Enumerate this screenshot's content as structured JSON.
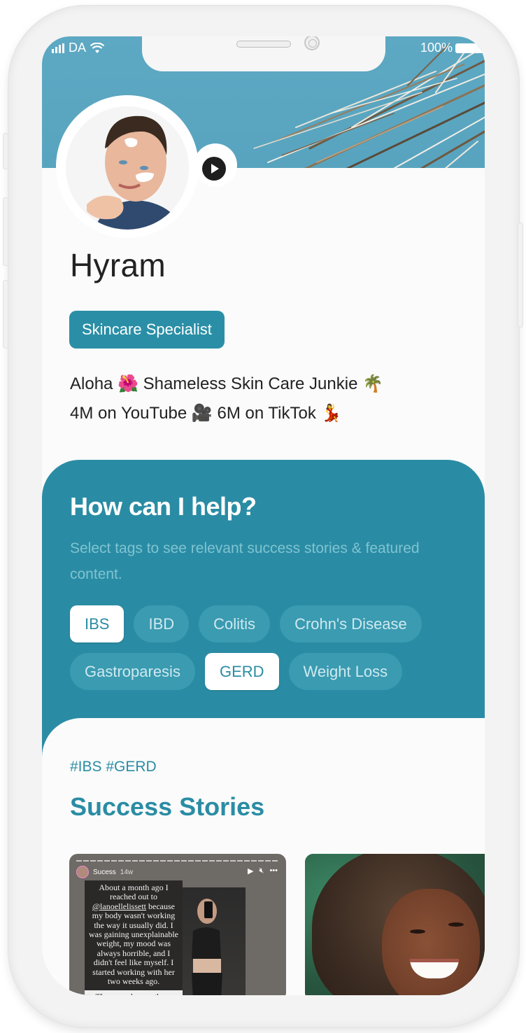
{
  "status_bar": {
    "carrier": "DA",
    "battery": "100%"
  },
  "profile": {
    "name": "Hyram",
    "role": "Skincare Specialist",
    "bio_line1": "Aloha 🌺 Shameless Skin Care Junkie 🌴",
    "bio_line2": "4M on YouTube 🎥 6M on TikTok 💃",
    "play_icon": "play-icon"
  },
  "help": {
    "title": "How can I help?",
    "subtitle": "Select tags to see relevant success stories & featured content.",
    "tags": [
      {
        "label": "IBS",
        "selected": true
      },
      {
        "label": "IBD",
        "selected": false
      },
      {
        "label": "Colitis",
        "selected": false
      },
      {
        "label": "Crohn's Disease",
        "selected": false
      },
      {
        "label": "Gastroparesis",
        "selected": false
      },
      {
        "label": "GERD",
        "selected": true
      },
      {
        "label": "Weight Loss",
        "selected": false
      }
    ]
  },
  "stories": {
    "hashtags": "#IBS #GERD",
    "title": "Success Stories",
    "cards": [
      {
        "account": "Sucess",
        "time": "14w",
        "text_mention": "@lanoellelissett",
        "text_before": "About a month ago I reached out to",
        "text_after": "because my body wasn't working the way it usually did. I was gaining unexplainable weight, my mood was always horrible, and I didn't feel like myself. I started working with her two weeks ago.",
        "text_continued": "Three weeks ago these"
      },
      {
        "image": "smiling-woman-photo"
      }
    ]
  },
  "colors": {
    "brand": "#2a8ca4",
    "cover": "#5da8c3",
    "text": "#222222"
  }
}
